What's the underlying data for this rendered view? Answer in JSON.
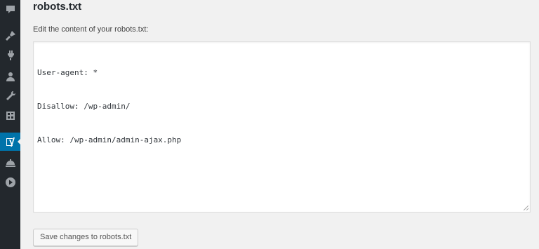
{
  "sidebar": {
    "items": [
      {
        "icon": "comments-icon"
      },
      {
        "icon": "appearance-icon"
      },
      {
        "icon": "plugins-icon"
      },
      {
        "icon": "users-icon"
      },
      {
        "icon": "tools-icon"
      },
      {
        "icon": "settings-icon"
      },
      {
        "icon": "yoast-seo-icon",
        "active": true
      },
      {
        "icon": "menu-item-icon"
      },
      {
        "icon": "play-icon"
      }
    ],
    "active_color": "#0073aa",
    "background": "#23282d"
  },
  "page": {
    "title": "robots.txt",
    "instructions": "Edit the content of your robots.txt:"
  },
  "editor": {
    "lines": [
      "User-agent: *",
      "Disallow: /wp-admin/",
      "Allow: /wp-admin/admin-ajax.php"
    ]
  },
  "actions": {
    "save_label": "Save changes to robots.txt"
  }
}
